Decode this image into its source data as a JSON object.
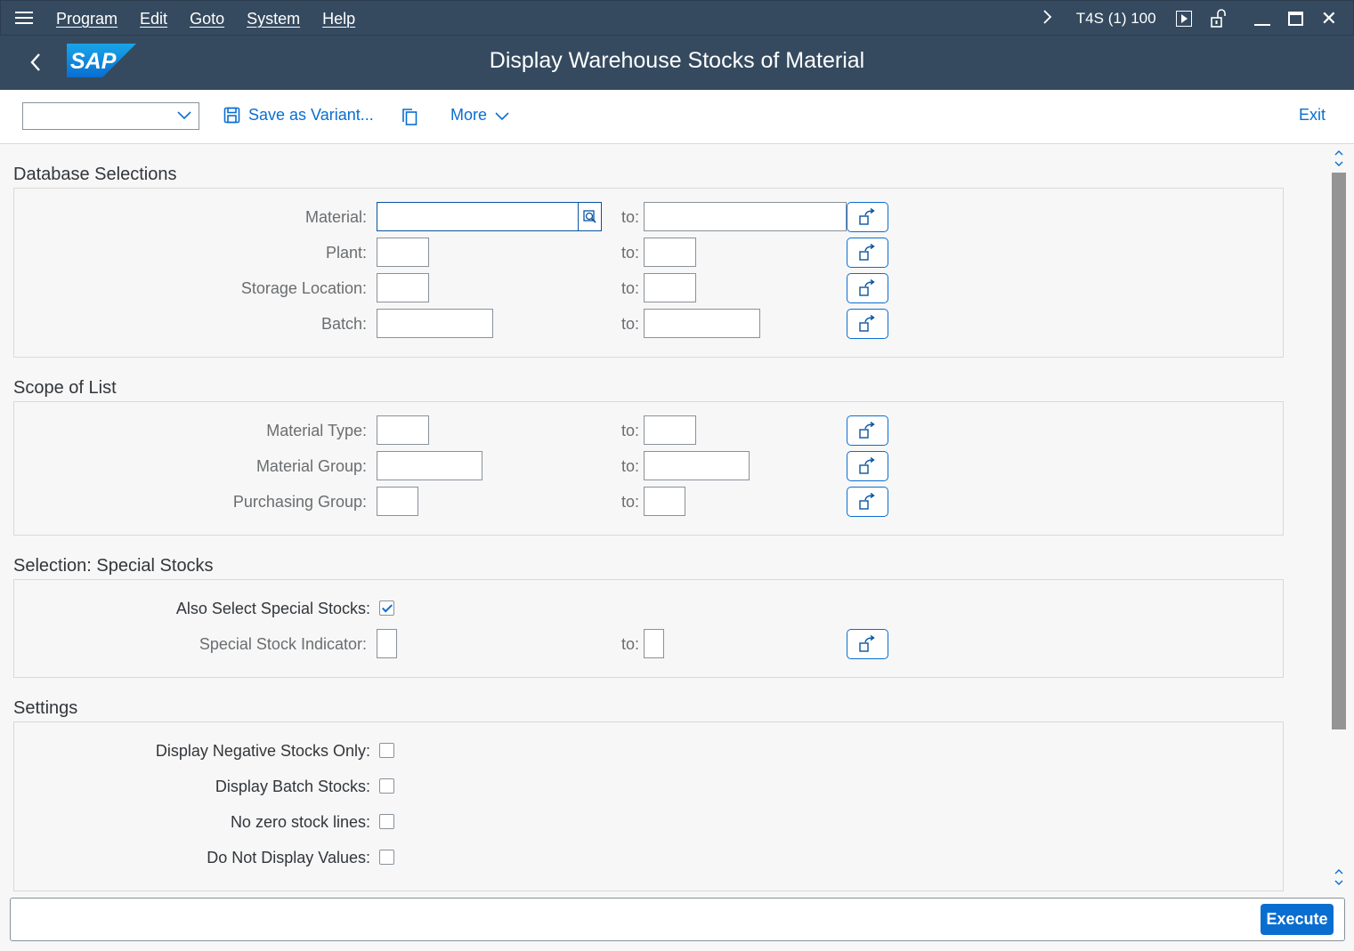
{
  "menubar": {
    "items": [
      "Program",
      "Edit",
      "Goto",
      "System",
      "Help"
    ],
    "system_info": "T4S (1) 100"
  },
  "shell": {
    "logo_text": "SAP",
    "title": "Display Warehouse Stocks of Material"
  },
  "toolbar": {
    "variant_value": "",
    "save_variant_label": "Save as Variant...",
    "more_label": "More",
    "exit_label": "Exit"
  },
  "sections": {
    "database": {
      "title": "Database Selections",
      "material_label": "Material:",
      "plant_label": "Plant:",
      "storage_location_label": "Storage Location:",
      "batch_label": "Batch:"
    },
    "scope": {
      "title": "Scope of List",
      "material_type_label": "Material Type:",
      "material_group_label": "Material Group:",
      "purchasing_group_label": "Purchasing Group:"
    },
    "special": {
      "title": "Selection: Special Stocks",
      "also_select_label": "Also Select Special Stocks:",
      "also_select_checked": true,
      "special_indicator_label": "Special Stock Indicator:"
    },
    "settings": {
      "title": "Settings",
      "negative_label": "Display Negative Stocks Only:",
      "batch_stocks_label": "Display Batch Stocks:",
      "no_zero_label": "No zero stock lines:",
      "no_values_label": "Do Not Display Values:"
    }
  },
  "common": {
    "to_label": "to:"
  },
  "footer": {
    "execute_label": "Execute"
  },
  "colors": {
    "shell": "#354a5f",
    "accent": "#0a6ed1",
    "background": "#f7f7f7"
  }
}
